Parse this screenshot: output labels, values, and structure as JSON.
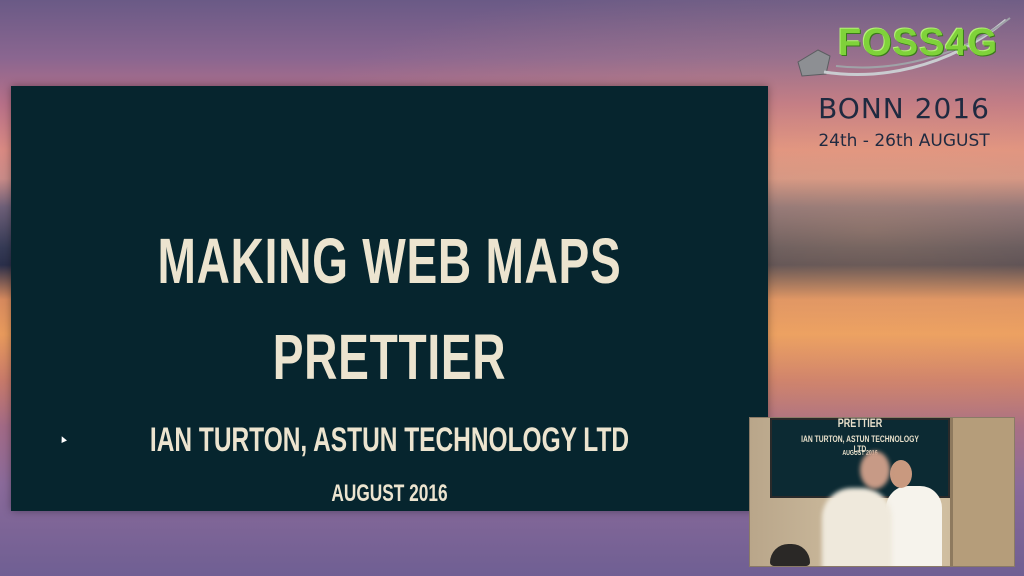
{
  "slide": {
    "title_line1": "MAKING WEB MAPS",
    "title_line2": "PRETTIER",
    "author": "IAN TURTON, ASTUN TECHNOLOGY LTD",
    "date": "AUGUST 2016"
  },
  "conference": {
    "name": "FOSS4G",
    "location_year": "BONN 2016",
    "dates": "24th - 26th AUGUST"
  },
  "speaker_inset": {
    "screen_title": "PRETTIER",
    "screen_author": "IAN TURTON, ASTUN TECHNOLOGY LTD",
    "screen_date": "AUGUST 2016"
  },
  "colors": {
    "slide_background": "#06252e",
    "slide_text": "#ece4cf",
    "logo_green": "#7fd23a",
    "logo_text": "#1f2a40"
  }
}
